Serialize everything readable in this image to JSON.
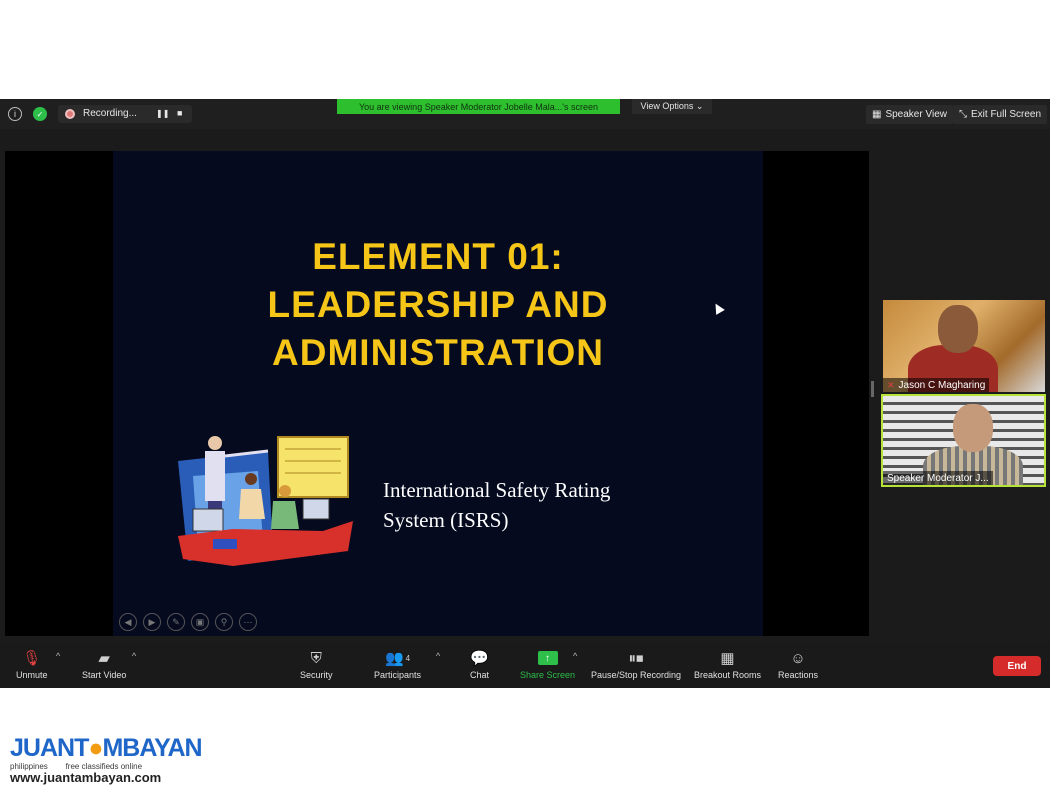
{
  "topbar": {
    "info_icon": "info-icon",
    "security_icon": "shield-check-icon",
    "recording_label": "Recording...",
    "pause_glyph": "❚❚",
    "stop_glyph": "■",
    "banner_text": "You are viewing Speaker Moderator Jobelle Mala...'s screen",
    "view_options_label": "View Options ⌄",
    "speaker_view_label": "Speaker View",
    "exit_fullscreen_label": "Exit Full Screen"
  },
  "slide": {
    "title": "ELEMENT 01:\nLEADERSHIP AND\nADMINISTRATION",
    "subtitle": "International Safety Rating\nSystem (ISRS)",
    "controls": [
      "◀",
      "▶",
      "✎",
      "▣",
      "⚲",
      "⋯"
    ]
  },
  "participants": [
    {
      "name": "Jason C Magharing",
      "muted": true
    },
    {
      "name": "Speaker Moderator J...",
      "muted": false,
      "active_speaker": true
    }
  ],
  "toolbar": {
    "unmute_label": "Unmute",
    "start_video_label": "Start Video",
    "security_label": "Security",
    "participants_label": "Participants",
    "participants_count": "4",
    "chat_label": "Chat",
    "share_screen_label": "Share Screen",
    "recording_label": "Pause/Stop Recording",
    "breakout_label": "Breakout Rooms",
    "reactions_label": "Reactions",
    "end_label": "End",
    "accent_green": "#2dbf4a",
    "end_red": "#d62b2b"
  },
  "watermark": {
    "logo_part1": "JUANT",
    "logo_part2": "MBAYAN",
    "tagline": "philippines        free classifieds online",
    "url": "www.juantambayan.com"
  }
}
